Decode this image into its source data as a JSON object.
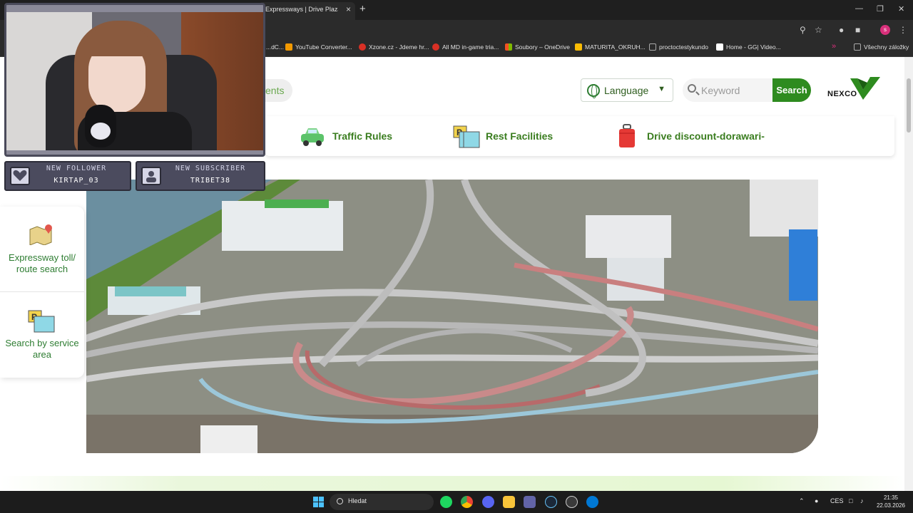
{
  "browser": {
    "tab_title": "Expressways | Drive Plaza DoRa",
    "tab_close": "×",
    "new_tab": "+",
    "window_controls": [
      "—",
      "❐",
      "✕"
    ],
    "toolbar_icons": [
      "zoom-icon",
      "star-icon",
      "extension-icon",
      "extensions-puzzle-icon",
      "profile-icon",
      "menu-icon"
    ],
    "profile_initial": "s",
    "bookmarks": [
      {
        "label": "...dC...",
        "color": "#8ab4f8"
      },
      {
        "label": "YouTube Converter...",
        "color": "#f29900"
      },
      {
        "label": "Xzone.cz - Jdeme hr...",
        "color": "#d93025"
      },
      {
        "label": "All MD in-game tria...",
        "color": "#d93025"
      },
      {
        "label": "Soubory – OneDrive",
        "color": "#4285f4"
      },
      {
        "label": "MATURITA_OKRUH...",
        "color": "#fbbc04"
      },
      {
        "label": "proctoctestykundo",
        "color": "#8a8a8a"
      },
      {
        "label": "Home - GG| Video...",
        "color": "#ffffff"
      }
    ],
    "bookmarks_overflow": "»",
    "all_bookmarks": "Všechny záložky"
  },
  "header": {
    "events_label": "ents",
    "language": "Language",
    "language_arrow": "▼",
    "search_placeholder": "Keyword",
    "search_button": "Search",
    "logo_text": "NEXCO",
    "logo_color": "#2e8b1f"
  },
  "nav": [
    {
      "label": "Traffic Rules",
      "icon": "car-icon"
    },
    {
      "label": "Rest Facilities",
      "icon": "parking-icon"
    },
    {
      "label": "Drive discount-dorawari-",
      "icon": "suitcase-icon"
    }
  ],
  "sidebar": [
    {
      "label": "Expressway toll/ route search",
      "icon": "map-pin-icon"
    },
    {
      "label": "Search by service area",
      "icon": "parking-sign-icon"
    }
  ],
  "hero": {
    "subject": "highway-interchange-photo"
  },
  "stream_overlay": {
    "follower_title": "NEW FOLLOWER",
    "follower_name": "KIRTAP_03",
    "subscriber_title": "NEW SUBSCRIBER",
    "subscriber_name": "TRIBET38"
  },
  "taskbar": {
    "search_label": "Hledat",
    "apps": [
      "spotify-icon",
      "chrome-icon",
      "discord-icon",
      "folder-icon",
      "teams-icon",
      "steam-icon",
      "steam-alt-icon",
      "app-c-icon"
    ],
    "tray_arrow": "⌃",
    "language": "CES",
    "time": "21:35",
    "date": "22.03.2026"
  },
  "colors": {
    "brand_green": "#2e8b1f",
    "nav_green": "#3a7d1f",
    "accent_light_green": "#e6f7d3"
  }
}
